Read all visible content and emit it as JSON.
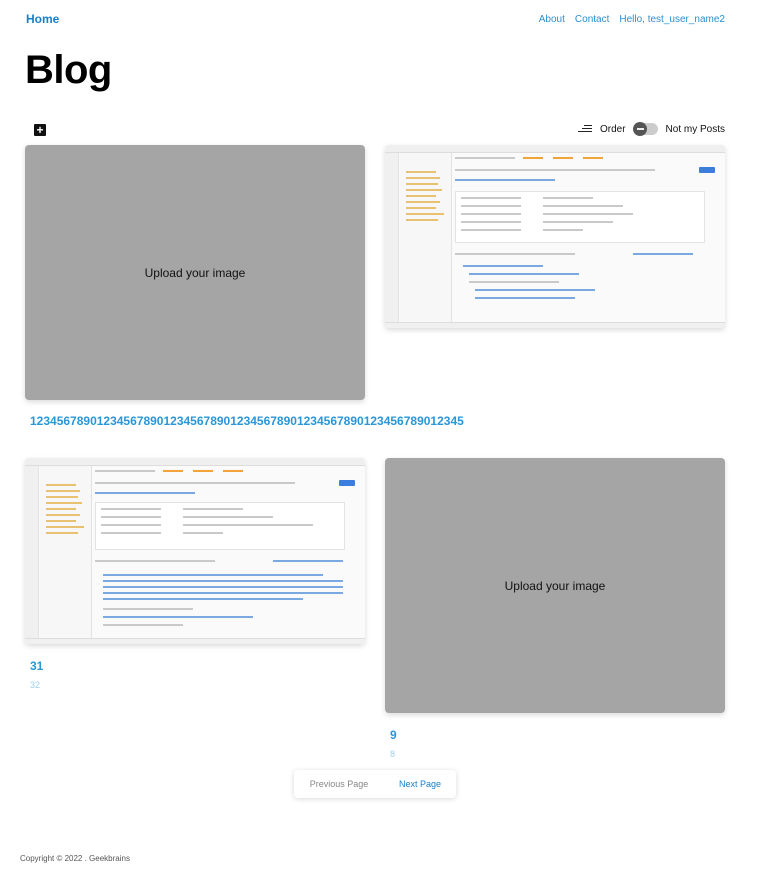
{
  "nav": {
    "home": "Home",
    "about": "About",
    "contact": "Contact",
    "greeting": "Hello, test_user_name2"
  },
  "page": {
    "title": "Blog"
  },
  "toolbar": {
    "add_icon": "plus-square-icon",
    "sort_icon": "sort-lines-icon",
    "order_label": "Order",
    "filter_label": "Not my Posts",
    "filter_on": false
  },
  "posts": [
    {
      "image_text": "Upload your image",
      "title": "12345678901234567890123456789012345678901234567890123456789012345",
      "subtitle": ""
    },
    {
      "image_text": "",
      "title": "",
      "subtitle": ""
    },
    {
      "image_text": "",
      "title": "31",
      "subtitle": "32"
    },
    {
      "image_text": "Upload your image",
      "title": "9",
      "subtitle": "8"
    }
  ],
  "pagination": {
    "prev": "Previous Page",
    "next": "Next Page"
  },
  "footer": {
    "copyright": "Copyright © 2022 . Geekbrains"
  },
  "colors": {
    "accent": "#2a96d8",
    "placeholder": "#a5a5a5",
    "subtitle": "#9fd0ef"
  }
}
